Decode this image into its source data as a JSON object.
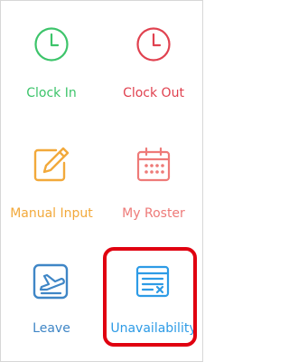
{
  "menu": {
    "items": [
      {
        "label": "Clock In",
        "icon": "clock-icon",
        "color": "#3cc46a"
      },
      {
        "label": "Clock Out",
        "icon": "clock-icon",
        "color": "#e0414f"
      },
      {
        "label": "Manual Input",
        "icon": "edit-note-icon",
        "color": "#f2a93b"
      },
      {
        "label": "My Roster",
        "icon": "calendar-icon",
        "color": "#ee7a78"
      },
      {
        "label": "Leave",
        "icon": "airplane-icon",
        "color": "#3f86c6"
      },
      {
        "label": "Unavailability",
        "icon": "unavailable-list-icon",
        "color": "#2d9be6"
      }
    ]
  },
  "highlight_color": "#e00010"
}
